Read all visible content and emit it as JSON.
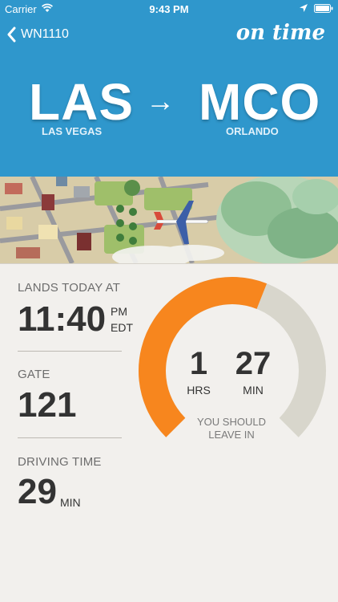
{
  "status_bar": {
    "carrier": "Carrier",
    "time": "9:43 PM"
  },
  "nav": {
    "back_label": "WN1110",
    "brand": "on time"
  },
  "route": {
    "origin_code": "LAS",
    "origin_city": "LAS VEGAS",
    "arrow": "→",
    "dest_code": "MCO",
    "dest_city": "ORLANDO"
  },
  "landing": {
    "label": "LANDS TODAY AT",
    "time": "11:40",
    "ampm": "PM",
    "zone": "EDT"
  },
  "gate": {
    "label": "GATE",
    "number": "121"
  },
  "driving": {
    "label": "DRIVING TIME",
    "value": "29",
    "unit": "MIN"
  },
  "countdown": {
    "hours": "1",
    "hours_unit": "HRS",
    "minutes": "27",
    "minutes_unit": "MIN",
    "caption_line1": "YOU SHOULD",
    "caption_line2": "LEAVE IN",
    "progress_fraction": 0.58
  },
  "colors": {
    "header": "#2f97cc",
    "accent": "#f7861e",
    "track": "#d8d6cc",
    "background": "#f2f0ed"
  }
}
